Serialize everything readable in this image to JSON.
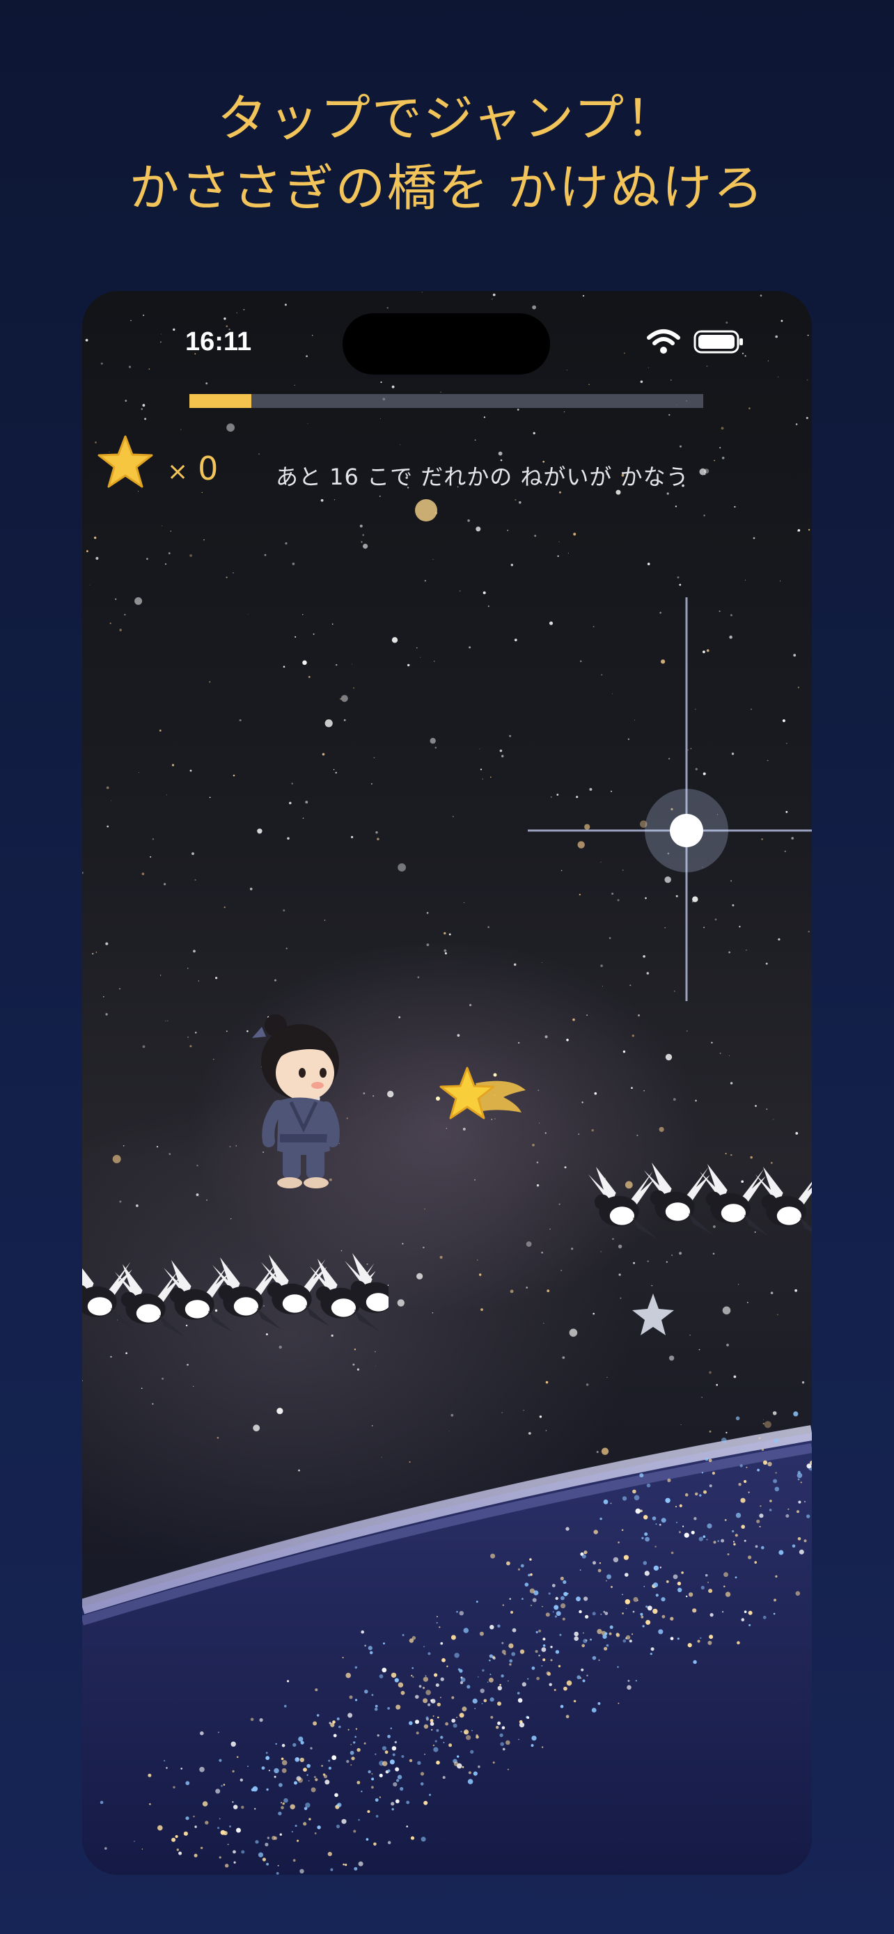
{
  "marketing": {
    "headline_line1": "タップでジャンプ！",
    "headline_line2": "かささぎの橋を かけぬけろ"
  },
  "status_bar": {
    "time": "16:11",
    "icons": [
      "wifi-icon",
      "battery-icon"
    ]
  },
  "hud": {
    "progress_fraction": 0.12,
    "star_count_prefix": "×",
    "star_count": "0",
    "hint": "あと 16 こで だれかの ねがいが かなう",
    "star_icon": "star-icon"
  },
  "game_scene": {
    "player": "player-character",
    "collectible": "shooting-star-icon",
    "platforms": [
      "magpie-bridge-left",
      "magpie-bridge-right"
    ],
    "background": "night-sky-milky-way"
  },
  "colors": {
    "accent": "#f4c44e",
    "background": "#0d1633",
    "hud_text": "#e6e6ea"
  }
}
